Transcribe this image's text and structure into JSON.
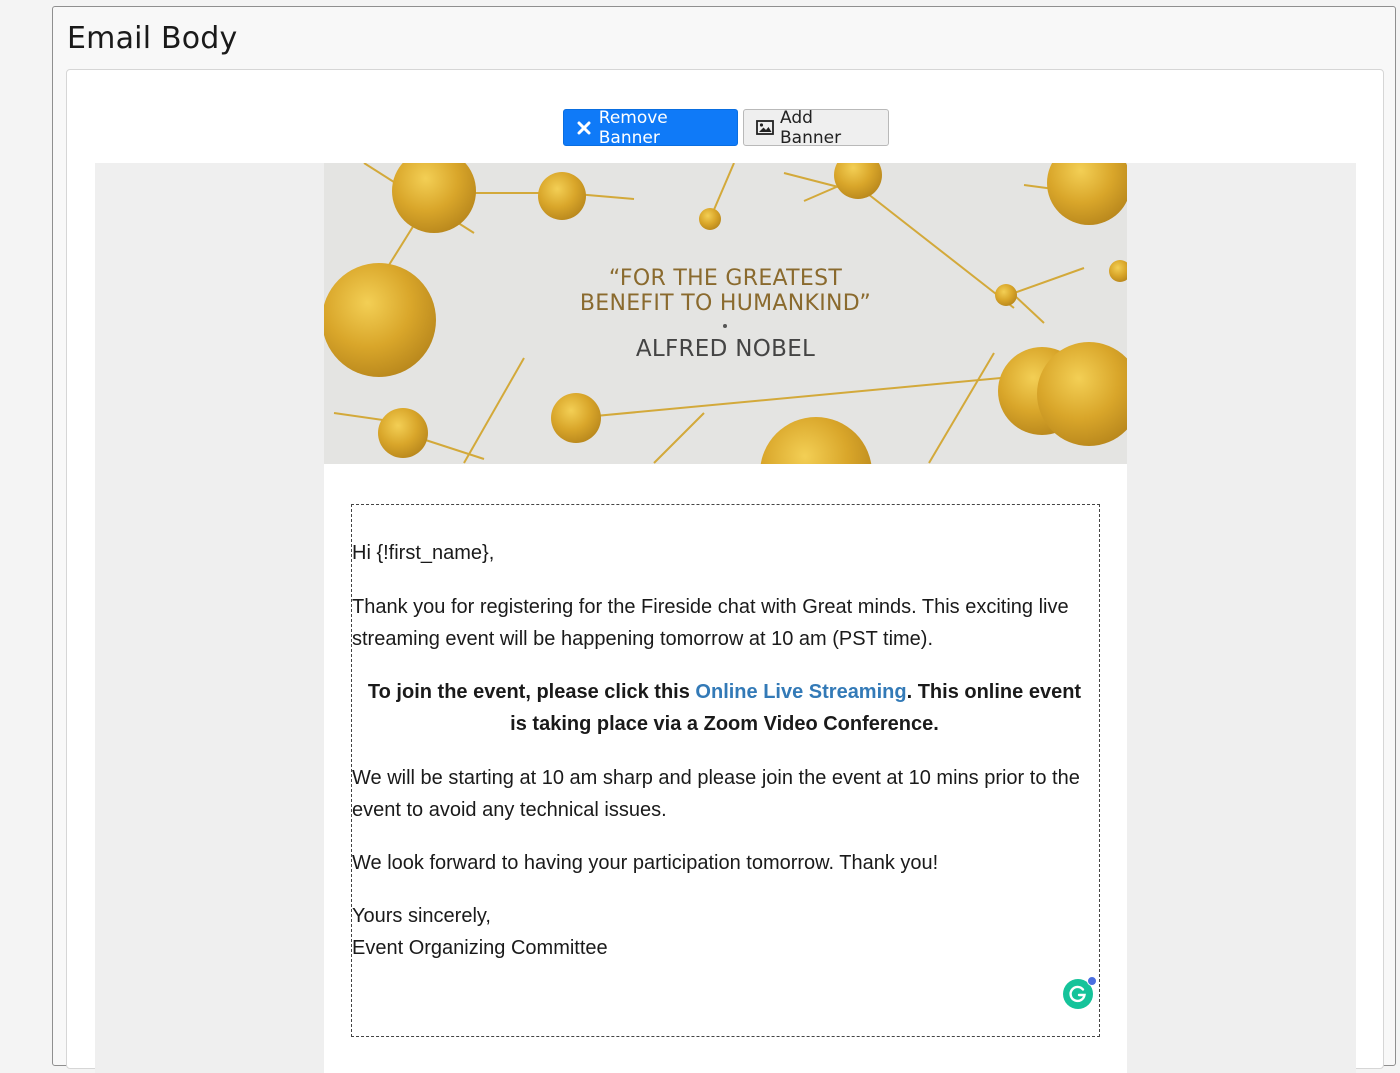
{
  "page": {
    "title": "Email Body"
  },
  "toolbar": {
    "remove_banner_label": "Remove Banner",
    "add_banner_label": "Add Banner"
  },
  "banner": {
    "quote_line1": "“FOR THE GREATEST",
    "quote_line2": "BENEFIT TO HUMANKIND”",
    "author": "ALFRED NOBEL"
  },
  "email": {
    "greeting": "Hi {!first_name},",
    "thanks": "Thank you for registering for the Fireside chat with Great minds. This exciting live streaming event will be happening tomorrow at 10 am (PST time).",
    "join_prefix": "To join the event, please click this ",
    "join_link": "Online Live Streaming",
    "join_suffix": ". This online event is taking place via a Zoom Video Conference.",
    "start": "We will be starting at 10 am sharp and please join the event at 10 mins prior to the event to avoid any technical issues.",
    "forward": "We look forward to having your participation tomorrow. Thank you!",
    "sign_line1": "Yours sincerely,",
    "sign_line2": "Event Organizing Committee"
  },
  "icons": {
    "remove": "close-icon",
    "add": "image-icon",
    "grammarly": "grammarly-icon"
  },
  "colors": {
    "primary_button": "#0f7af8",
    "link": "#337ab7",
    "gold": "#d4a32a",
    "grammarly": "#15c39a"
  }
}
